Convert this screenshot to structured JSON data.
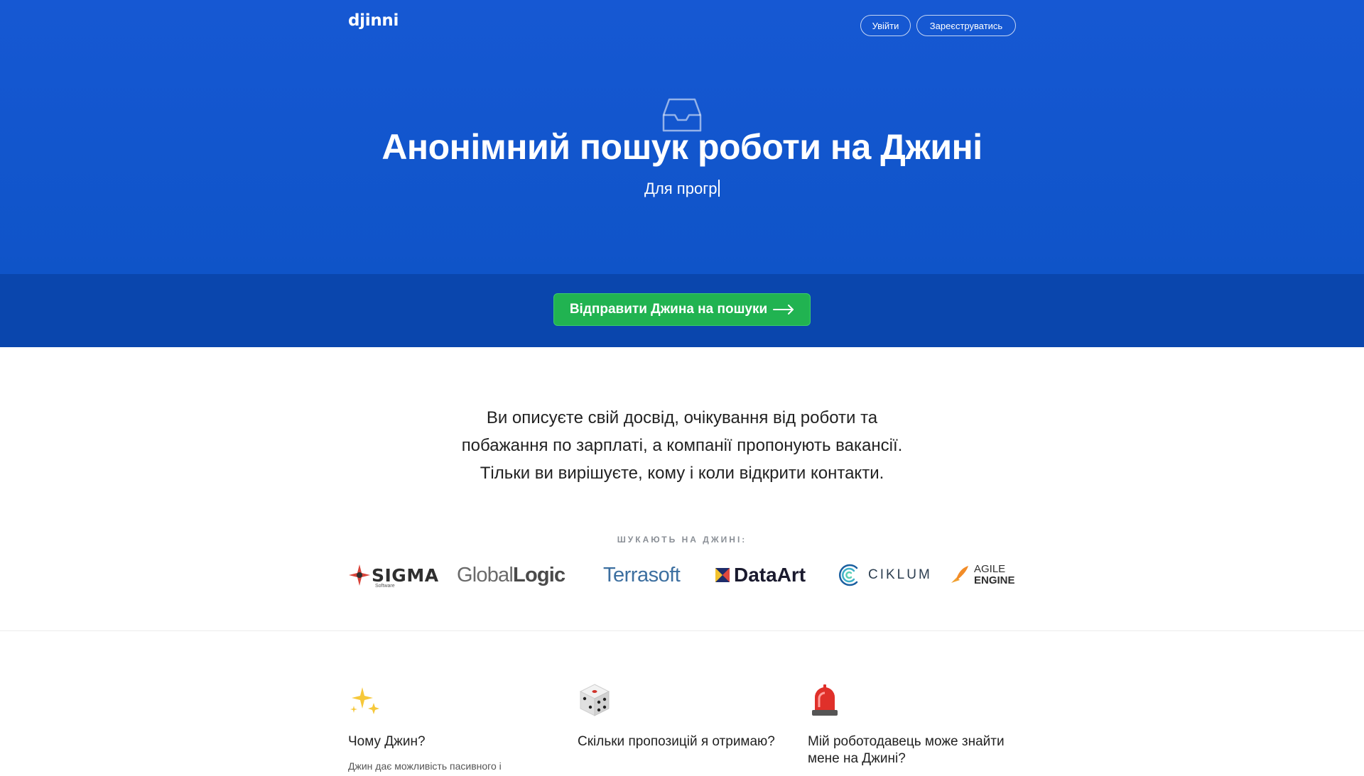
{
  "header": {
    "logo": "djinni",
    "login_label": "Увійти",
    "register_label": "Зареєструватись"
  },
  "hero": {
    "title": "Анонімний пошук роботи на Джині",
    "subtitle_typing": "Для прогр",
    "icon": "inbox-icon"
  },
  "cta": {
    "label": "Відправити Джина на пошуки",
    "icon": "arrow-right-icon"
  },
  "description": {
    "lines": [
      "Ви описуєте свій досвід, очікування від роботи та",
      "побажання по зарплаті, а компанії пропонують вакансії.",
      "Тільки ви вирішуєте, кому і коли відкрити контакти."
    ]
  },
  "companies": {
    "heading": "ШУКАЮТЬ НА ДЖИНІ:",
    "logos": [
      {
        "name": "SIGMA",
        "sub": "Software"
      },
      {
        "name_light": "Global",
        "name_bold": "Logic"
      },
      {
        "name": "Terrasoft"
      },
      {
        "name": "DataArt"
      },
      {
        "name": "CIKLUM"
      },
      {
        "line1": "AGILE",
        "line2": "ENGINE"
      }
    ]
  },
  "features": [
    {
      "icon": "sparkles-icon",
      "title": "Чому Джин?",
      "text": "Джин дає можливість пасивного і"
    },
    {
      "icon": "dice-icon",
      "title": "Скільки пропозицій я отримаю?",
      "text": ""
    },
    {
      "icon": "siren-icon",
      "title": "Мій роботодавець може знайти мене на Джині?",
      "text": ""
    }
  ],
  "colors": {
    "hero_bg": "#1658d3",
    "band_bg": "#0a46ad",
    "cta_bg": "#21b351"
  }
}
